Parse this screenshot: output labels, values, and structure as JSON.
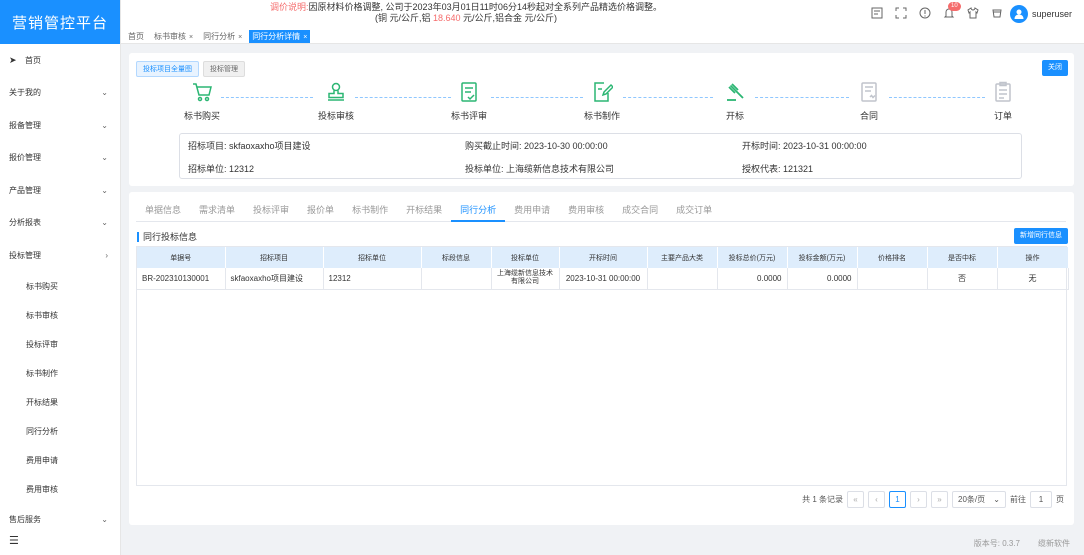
{
  "app": {
    "title": "营销管控平台"
  },
  "sidebar": {
    "items": [
      {
        "label": "首页",
        "icon": "send-icon"
      },
      {
        "label": "关于我的",
        "chevron": "down"
      },
      {
        "label": "报备管理",
        "chevron": "down"
      },
      {
        "label": "报价管理",
        "chevron": "down"
      },
      {
        "label": "产品管理",
        "chevron": "down"
      },
      {
        "label": "分析报表",
        "chevron": "down"
      },
      {
        "label": "投标管理",
        "chevron": "up"
      }
    ],
    "sub_items": [
      "标书购买",
      "标书审核",
      "投标评审",
      "标书制作",
      "开标结果",
      "同行分析",
      "费用申请",
      "费用审核"
    ],
    "after_items": [
      {
        "label": "售后服务",
        "chevron": "down"
      }
    ]
  },
  "header": {
    "notice_prefix": "调价说明:",
    "notice_line1": "因原材料价格调整, 公司于2023年03月01日11时06分14秒起对全系列产品精选价格调整。",
    "notice_line2_a": "(铜 元/公斤,铝 ",
    "notice_line2_value": "18.640",
    "notice_line2_b": " 元/公斤,铝合金 元/公斤)",
    "notification_count": "10",
    "username": "superuser"
  },
  "tabs": [
    {
      "label": "首页",
      "closable": false,
      "active": false
    },
    {
      "label": "标书审核",
      "closable": true,
      "active": false
    },
    {
      "label": "同行分析",
      "closable": true,
      "active": false
    },
    {
      "label": "同行分析详情",
      "closable": true,
      "active": true
    }
  ],
  "top_card": {
    "btn_overview": "投标项目全量图",
    "btn_manage": "投标管理",
    "btn_close": "关闭",
    "steps": [
      {
        "label": "标书购买",
        "state": "done"
      },
      {
        "label": "投标审核",
        "state": "done"
      },
      {
        "label": "标书评审",
        "state": "done"
      },
      {
        "label": "标书制作",
        "state": "done"
      },
      {
        "label": "开标",
        "state": "done"
      },
      {
        "label": "合同",
        "state": "todo"
      },
      {
        "label": "订单",
        "state": "todo"
      }
    ],
    "info": {
      "project": "招标项目: skfaoxaxho项目建设",
      "deadline": "购买截止时间: 2023-10-30 00:00:00",
      "open_time": "开标时间: 2023-10-31 00:00:00",
      "tender_unit": "招标单位: 12312",
      "bid_unit": "投标单位: 上海缆新信息技术有限公司",
      "rep": "授权代表: 121321"
    }
  },
  "process_tabs": [
    "单据信息",
    "需求清单",
    "投标评审",
    "报价单",
    "标书制作",
    "开标结果",
    "同行分析",
    "费用申请",
    "费用审核",
    "成交合同",
    "成交订单"
  ],
  "active_process_tab": 6,
  "section": {
    "title": "同行投标信息",
    "add_button": "新增同行信息"
  },
  "table": {
    "columns": [
      "单据号",
      "招标项目",
      "招标单位",
      "标段信息",
      "投标单位",
      "开标时间",
      "主要产品大类",
      "投标总价(万元)",
      "投标金额(万元)",
      "价格排名",
      "是否中标",
      "操作"
    ],
    "rows": [
      [
        "BR-202310130001",
        "skfaoxaxho项目建设",
        "12312",
        "",
        "上海缆新信息技术有限公司",
        "2023-10-31 00:00:00",
        "",
        "0.0000",
        "0.0000",
        "",
        "否",
        "无"
      ]
    ]
  },
  "pagination": {
    "total": "共 1 条记录",
    "current_page": "1",
    "page_size": "20条/页",
    "goto_label": "前往",
    "goto_value": "1",
    "page_unit": "页"
  },
  "footer": {
    "version": "版本号: 0.3.7",
    "company": "缆新软件"
  },
  "colors": {
    "accent": "#1a90ff",
    "step_done": "#2bb673",
    "step_todo": "#c0c4cc",
    "alert": "#f56c6c"
  }
}
